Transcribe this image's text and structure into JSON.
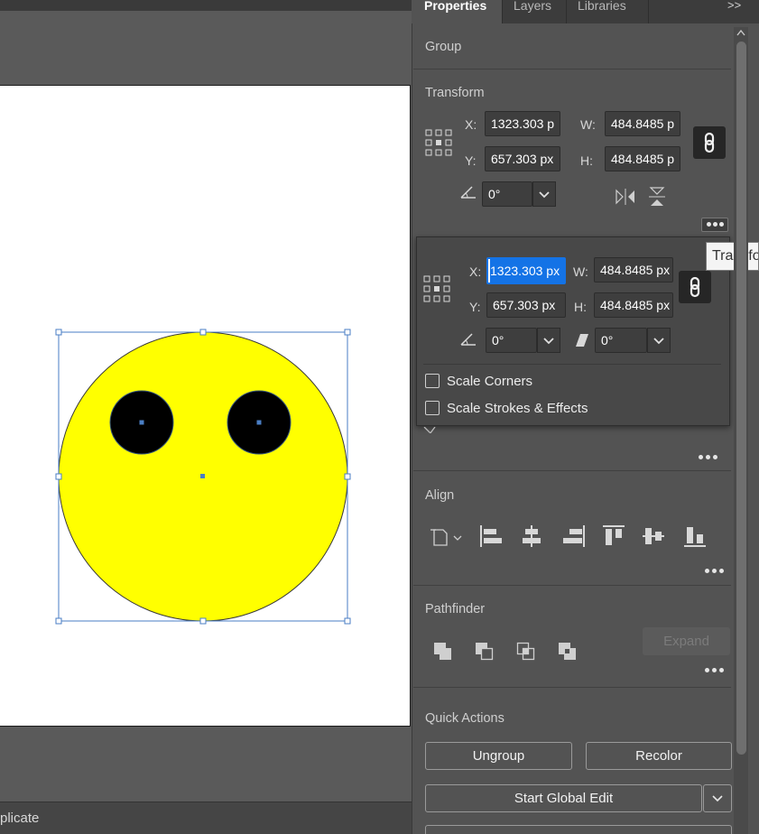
{
  "app": {
    "accent_color": "#1473e6"
  },
  "tabs": [
    {
      "label": "Properties",
      "active": true
    },
    {
      "label": "Layers",
      "active": false
    },
    {
      "label": "Libraries",
      "active": false
    }
  ],
  "panel_menu_glyph": ">>",
  "selection_type": "Group",
  "transform": {
    "title": "Transform",
    "x_label": "X:",
    "y_label": "Y:",
    "w_label": "W:",
    "h_label": "H:",
    "x_value": "1323.303 p",
    "y_value": "657.303 px",
    "w_value": "484.8485 p",
    "h_value": "484.8485 p",
    "angle_value": "0°",
    "angle_label": "∠:"
  },
  "transform_popup": {
    "x_value": "1323.303 px",
    "x_visible": "1323.303 px",
    "y_value": "657.303 px",
    "w_value": "484.8485 px",
    "h_value": "484.8485 px",
    "angle_value": "0°",
    "shear_value": "0°",
    "scale_corners_label": "Scale Corners",
    "scale_strokes_label": "Scale Strokes & Effects",
    "scale_corners_checked": false,
    "scale_strokes_checked": false
  },
  "tooltip": "Transform",
  "align": {
    "title": "Align"
  },
  "pathfinder": {
    "title": "Pathfinder",
    "expand_label": "Expand"
  },
  "quick_actions": {
    "title": "Quick Actions",
    "ungroup_label": "Ungroup",
    "recolor_label": "Recolor",
    "global_edit_label": "Start Global Edit"
  },
  "status_bar": {
    "text": "plicate"
  },
  "artwork": {
    "face_color": "#ffff00",
    "eye_color": "#000000",
    "selection_color": "#4a7ec4"
  }
}
